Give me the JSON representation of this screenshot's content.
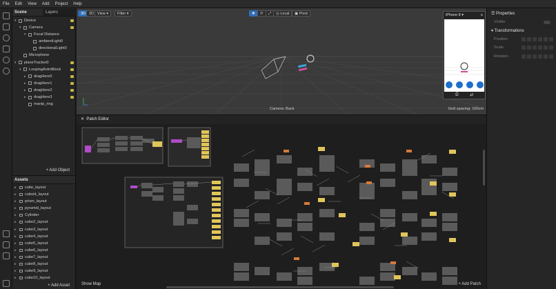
{
  "menu": [
    "File",
    "Edit",
    "View",
    "Add",
    "Project",
    "Help"
  ],
  "scene": {
    "title": "Scene",
    "layers_tab": "Layers",
    "items": [
      {
        "label": "Device",
        "indent": 0,
        "arrow": "▾",
        "badge": true
      },
      {
        "label": "Camera",
        "indent": 1,
        "arrow": "▾",
        "badge": true
      },
      {
        "label": "Focal Distance",
        "indent": 2,
        "arrow": "▾",
        "badge": false
      },
      {
        "label": "ambientLight0",
        "indent": 3,
        "arrow": "",
        "badge": false
      },
      {
        "label": "directionalLight0",
        "indent": 3,
        "arrow": "",
        "badge": false
      },
      {
        "label": "Microphone",
        "indent": 1,
        "arrow": "",
        "badge": false
      },
      {
        "label": "planeTracker0",
        "indent": 0,
        "arrow": "▾",
        "badge": true
      },
      {
        "label": "LoopingAnimBlock",
        "indent": 1,
        "arrow": "▾",
        "badge": true
      },
      {
        "label": "dragHere0",
        "indent": 2,
        "arrow": "▸",
        "badge": true
      },
      {
        "label": "dragHere1",
        "indent": 2,
        "arrow": "▸",
        "badge": true
      },
      {
        "label": "dragHere2",
        "indent": 2,
        "arrow": "▸",
        "badge": true
      },
      {
        "label": "dragHere3",
        "indent": 2,
        "arrow": "▸",
        "badge": true
      },
      {
        "label": "manip_ring",
        "indent": 2,
        "arrow": "",
        "badge": false
      }
    ],
    "add_object": "+ Add Object"
  },
  "assets": {
    "title": "Assets",
    "items": [
      "cube_layout",
      "cuboid_layout",
      "prism_layout",
      "pyramid_layout",
      "Cylinder",
      "cube2_layout",
      "cube3_layout",
      "cube4_layout",
      "cube5_layout",
      "cube6_layout",
      "cube7_layout",
      "cube8_layout",
      "cube9_layout",
      "cube10_layout"
    ],
    "add_asset": "+ Add Asset"
  },
  "viewport": {
    "mode_3d": "3D",
    "mode_2d": "2D",
    "view_label": "View",
    "filter_label": "Filter",
    "local_label": "Local",
    "pivot_label": "Pivot",
    "camera_label": "Camera: Back",
    "grid_label": "Grid spacing: 100cm",
    "device": "iPhone 8"
  },
  "properties": {
    "title": "Properties",
    "visible_label": "Visible",
    "transformations": "Transformations",
    "rows": [
      "Position",
      "Scale",
      "Rotation"
    ]
  },
  "patch_editor": {
    "title": "Patch Editor",
    "show_map": "Show Map",
    "add_patch": "+ Add Patch"
  },
  "colors": {
    "accent": "#2f6db5",
    "patch_yellow": "#e0c55a",
    "patch_purple": "#b04cc8",
    "patch_orange": "#d77a3a",
    "node_gray": "#5a5a5a"
  }
}
